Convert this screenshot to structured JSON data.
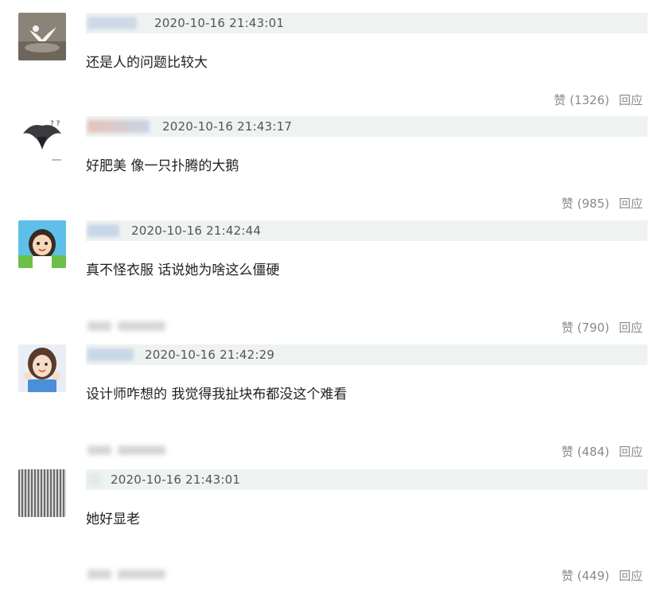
{
  "comments": [
    {
      "username_masked": "",
      "time": "2020-10-16 21:43:01",
      "text": "还是人的问题比较大",
      "like_label": "赞",
      "like_count": "(1326)",
      "reply_label": "回应"
    },
    {
      "username_masked": "",
      "time": "2020-10-16 21:43:17",
      "text": "好肥美 像一只扑腾的大鹅",
      "like_label": "赞",
      "like_count": "(985)",
      "reply_label": "回应"
    },
    {
      "username_masked": "",
      "time": "2020-10-16 21:42:44",
      "text": "真不怪衣服 话说她为啥这么僵硬",
      "like_label": "赞",
      "like_count": "(790)",
      "reply_label": "回应"
    },
    {
      "username_masked": "",
      "time": "2020-10-16 21:42:29",
      "text": "设计师咋想的 我觉得我扯块布都没这个难看",
      "like_label": "赞",
      "like_count": "(484)",
      "reply_label": "回应"
    },
    {
      "username_masked": "",
      "time": "2020-10-16 21:43:01",
      "text": "她好显老",
      "like_label": "赞",
      "like_count": "(449)",
      "reply_label": "回应"
    }
  ],
  "colors": {
    "meta_bg": "#eef3f1",
    "time_text": "#555555",
    "action_text": "#8a8a8a"
  },
  "icons": [
    "avatar-bird",
    "avatar-bat",
    "avatar-cartoon-girl",
    "avatar-photo-girl",
    "avatar-striped"
  ]
}
